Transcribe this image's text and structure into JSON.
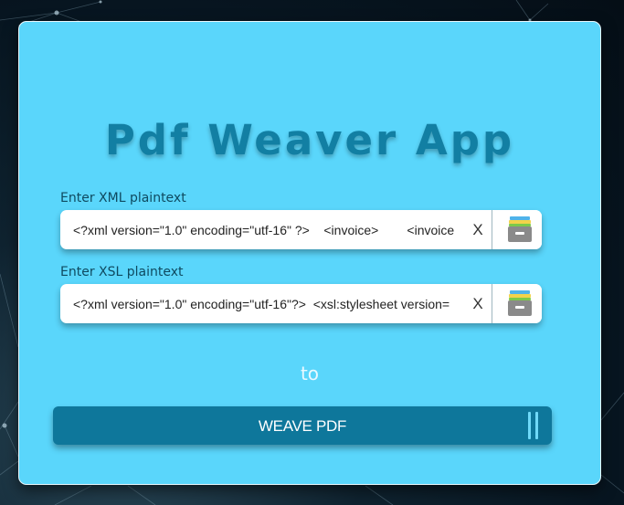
{
  "app": {
    "title": "Pdf Weaver App"
  },
  "xml_field": {
    "label": "Enter XML plaintext",
    "value": "<?xml version=\"1.0\" encoding=\"utf-16\" ?>    <invoice>        <invoice",
    "clear_label": "X",
    "archive_icon": "archive-box-icon"
  },
  "xsl_field": {
    "label": "Enter XSL plaintext",
    "value": "<?xml version=\"1.0\" encoding=\"utf-16\"?>  <xsl:stylesheet version=",
    "clear_label": "X",
    "archive_icon": "archive-box-icon"
  },
  "separator_text": "to",
  "action": {
    "weave_label": "WEAVE PDF",
    "handle_icon": "double-bar-icon"
  },
  "colors": {
    "card_background": "#5ad6fb",
    "title": "#127fa3",
    "button": "#0e779b",
    "accent": "#6fd9f8"
  }
}
